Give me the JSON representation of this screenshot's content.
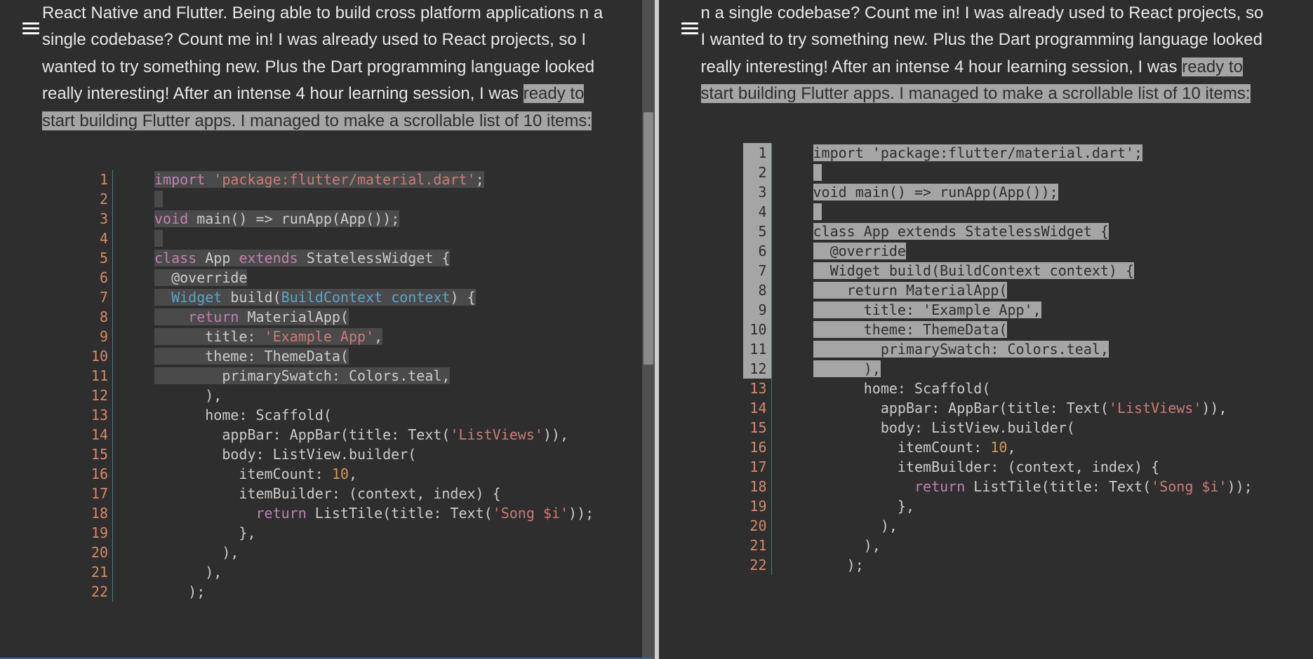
{
  "left": {
    "para_pre": "React Native and Flutter. Being able to build cross platform applications\nn a single codebase? Count me in! I was already used to React projects,\nso I wanted to try something new. Plus the Dart programming language\nlooked really interesting! After an intense 4 hour learning session, I was ",
    "para_hl": "ready to start building Flutter apps. I managed to make a scrollable list of 10 items:",
    "code": {
      "highlight_through": 11,
      "lines": [
        [
          [
            "kw",
            "import"
          ],
          [
            "punct",
            " "
          ],
          [
            "str",
            "'package:flutter/material.dart'"
          ],
          [
            "punct",
            ";"
          ]
        ],
        [],
        [
          [
            "kw",
            "void"
          ],
          [
            "punct",
            " main"
          ],
          [
            "punct",
            "()"
          ],
          [
            "punct",
            " => runApp"
          ],
          [
            "punct",
            "("
          ],
          [
            "punct",
            "App"
          ],
          [
            "punct",
            "()"
          ],
          [
            "punct",
            ");"
          ]
        ],
        [],
        [
          [
            "kw",
            "class"
          ],
          [
            "punct",
            " App "
          ],
          [
            "kw",
            "extends"
          ],
          [
            "punct",
            " StatelessWidget {"
          ]
        ],
        [
          [
            "punct",
            "  "
          ],
          [
            "ann",
            "@override"
          ]
        ],
        [
          [
            "punct",
            "  "
          ],
          [
            "type",
            "Widget"
          ],
          [
            "punct",
            " "
          ],
          [
            "fn",
            "build"
          ],
          [
            "punct",
            "("
          ],
          [
            "type",
            "BuildContext context"
          ],
          [
            "punct",
            ")"
          ],
          [
            "punct",
            " {"
          ]
        ],
        [
          [
            "punct",
            "    "
          ],
          [
            "kw",
            "return"
          ],
          [
            "punct",
            " MaterialApp("
          ]
        ],
        [
          [
            "punct",
            "      title: "
          ],
          [
            "str",
            "'Example App'"
          ],
          [
            "punct",
            ","
          ]
        ],
        [
          [
            "punct",
            "      theme: ThemeData("
          ]
        ],
        [
          [
            "punct",
            "        primarySwatch: Colors.teal,"
          ]
        ],
        [
          [
            "punct",
            "      ),"
          ]
        ],
        [
          [
            "punct",
            "      home: Scaffold("
          ]
        ],
        [
          [
            "punct",
            "        appBar: AppBar(title: Text("
          ],
          [
            "str",
            "'ListViews'"
          ],
          [
            "punct",
            ")),"
          ]
        ],
        [
          [
            "punct",
            "        body: ListView.builder("
          ]
        ],
        [
          [
            "punct",
            "          itemCount: "
          ],
          [
            "num",
            "10"
          ],
          [
            "punct",
            ","
          ]
        ],
        [
          [
            "punct",
            "          itemBuilder: (context, index) {"
          ]
        ],
        [
          [
            "punct",
            "            "
          ],
          [
            "kw",
            "return"
          ],
          [
            "punct",
            " ListTile(title: Text("
          ],
          [
            "str",
            "'Song $i'"
          ],
          [
            "punct",
            "));"
          ]
        ],
        [
          [
            "punct",
            "          },"
          ]
        ],
        [
          [
            "punct",
            "        ),"
          ]
        ],
        [
          [
            "punct",
            "      ),"
          ]
        ],
        [
          [
            "punct",
            "    );"
          ]
        ]
      ]
    }
  },
  "right": {
    "para_pre": "n a single codebase? Count me in! I was already used to React projects,\nso I wanted to try something new. Plus the Dart programming language\nlooked really interesting! After an intense 4 hour learning session, I was ",
    "para_hl": "ready to start building Flutter apps. I managed to make a scrollable list of 10 items:",
    "code": {
      "highlight_through": 12,
      "full_highlight": true,
      "lines": [
        [
          [
            "punct",
            "import 'package:flutter/material.dart';"
          ]
        ],
        [],
        [
          [
            "punct",
            "void main() => runApp(App());"
          ]
        ],
        [],
        [
          [
            "punct",
            "class App extends StatelessWidget {"
          ]
        ],
        [
          [
            "punct",
            "  @override"
          ]
        ],
        [
          [
            "punct",
            "  Widget build(BuildContext context) {"
          ]
        ],
        [
          [
            "punct",
            "    return MaterialApp("
          ]
        ],
        [
          [
            "punct",
            "      title: 'Example App',"
          ]
        ],
        [
          [
            "punct",
            "      theme: ThemeData("
          ]
        ],
        [
          [
            "punct",
            "        primarySwatch: Colors.teal,"
          ]
        ],
        [
          [
            "punct",
            "      ),"
          ]
        ],
        [
          [
            "punct",
            "      home: Scaffold("
          ]
        ],
        [
          [
            "punct",
            "        appBar: AppBar(title: Text("
          ],
          [
            "str",
            "'ListViews'"
          ],
          [
            "punct",
            ")),"
          ]
        ],
        [
          [
            "punct",
            "        body: ListView.builder("
          ]
        ],
        [
          [
            "punct",
            "          itemCount: "
          ],
          [
            "num",
            "10"
          ],
          [
            "punct",
            ","
          ]
        ],
        [
          [
            "punct",
            "          itemBuilder: (context, index) {"
          ]
        ],
        [
          [
            "punct",
            "            "
          ],
          [
            "kw",
            "return"
          ],
          [
            "punct",
            " ListTile(title: Text("
          ],
          [
            "str",
            "'Song $i'"
          ],
          [
            "punct",
            "));"
          ]
        ],
        [
          [
            "punct",
            "          },"
          ]
        ],
        [
          [
            "punct",
            "        ),"
          ]
        ],
        [
          [
            "punct",
            "      ),"
          ]
        ],
        [
          [
            "punct",
            "    );"
          ]
        ]
      ]
    }
  }
}
